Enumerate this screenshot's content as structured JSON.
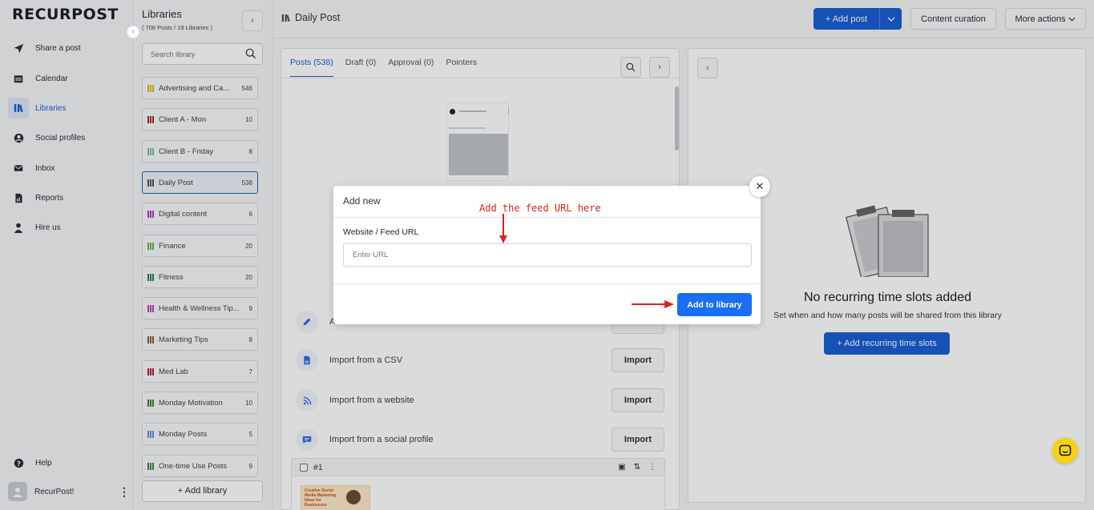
{
  "brand": {
    "logo_text": "RECURPOST"
  },
  "nav": {
    "items": [
      {
        "label": "Share a post",
        "icon": "send-icon"
      },
      {
        "label": "Calendar",
        "icon": "calendar-icon"
      },
      {
        "label": "Libraries",
        "icon": "library-icon",
        "active": true
      },
      {
        "label": "Social profiles",
        "icon": "profile-icon"
      },
      {
        "label": "Inbox",
        "icon": "inbox-icon"
      },
      {
        "label": "Reports",
        "icon": "reports-icon"
      },
      {
        "label": "Hire us",
        "icon": "person-icon"
      }
    ],
    "help_label": "Help",
    "user_name": "RecurPost!"
  },
  "libraries": {
    "title": "Libraries",
    "subtitle": "( 708 Posts / 19 Libraries )",
    "search_placeholder": "Search library",
    "items": [
      {
        "name": "Advertising and Ca...",
        "count": "546",
        "color": "#e6b422"
      },
      {
        "name": "Client A - Mon",
        "count": "10",
        "color": "#9b2b2b"
      },
      {
        "name": "Client B - Friday",
        "count": "8",
        "color": "#7fb8a8"
      },
      {
        "name": "Daily Post",
        "count": "538",
        "color": "#555555"
      },
      {
        "name": "Digital content",
        "count": "6",
        "color": "#a23fbf"
      },
      {
        "name": "Finance",
        "count": "20",
        "color": "#6ab04c"
      },
      {
        "name": "Fitness",
        "count": "20",
        "color": "#2f7d5a"
      },
      {
        "name": "Health & Wellness Tip...",
        "count": "9",
        "color": "#c03fb0"
      },
      {
        "name": "Marketing Tips",
        "count": "8",
        "color": "#8b5a3a"
      },
      {
        "name": "Med Lab",
        "count": "7",
        "color": "#a0243a"
      },
      {
        "name": "Monday Motivation",
        "count": "10",
        "color": "#3e7a3e"
      },
      {
        "name": "Monday Posts",
        "count": "5",
        "color": "#6b8fd6"
      },
      {
        "name": "One-time Use Posts",
        "count": "9",
        "color": "#4c7f4c"
      }
    ],
    "add_label": "+ Add library"
  },
  "topbar": {
    "page_title": "Daily Post",
    "add_post_label": "+ Add post",
    "content_curation_label": "Content curation",
    "more_actions_label": "More actions"
  },
  "center": {
    "tabs": [
      {
        "label": "Posts (538)",
        "active": true
      },
      {
        "label": "Draft (0)"
      },
      {
        "label": "Approval (0)"
      },
      {
        "label": "Pointers"
      }
    ],
    "import_rows": [
      {
        "label": "A",
        "button": ""
      },
      {
        "label": "Import from a CSV",
        "button": "Import"
      },
      {
        "label": "Import from a website",
        "button": "Import"
      },
      {
        "label": "Import from a social profile",
        "button": "Import"
      }
    ],
    "post_card": {
      "number": "#1",
      "thumb_text": "Creative Social Media Marketing Ideas for Businesses"
    }
  },
  "right": {
    "empty_title": "No recurring time slots added",
    "empty_subtitle": "Set when and how many posts will be shared from this library",
    "add_slot_label": "+ Add recurring time slots"
  },
  "modal": {
    "title": "Add new",
    "field_label": "Website / Feed URL",
    "input_placeholder": "Enter URL",
    "input_value": "",
    "submit_label": "Add to library",
    "annotation": "Add the feed URL here"
  },
  "colors": {
    "primary": "#1a5fd6",
    "annotation_red": "#e0201a",
    "help_fab": "#f5d40f"
  }
}
